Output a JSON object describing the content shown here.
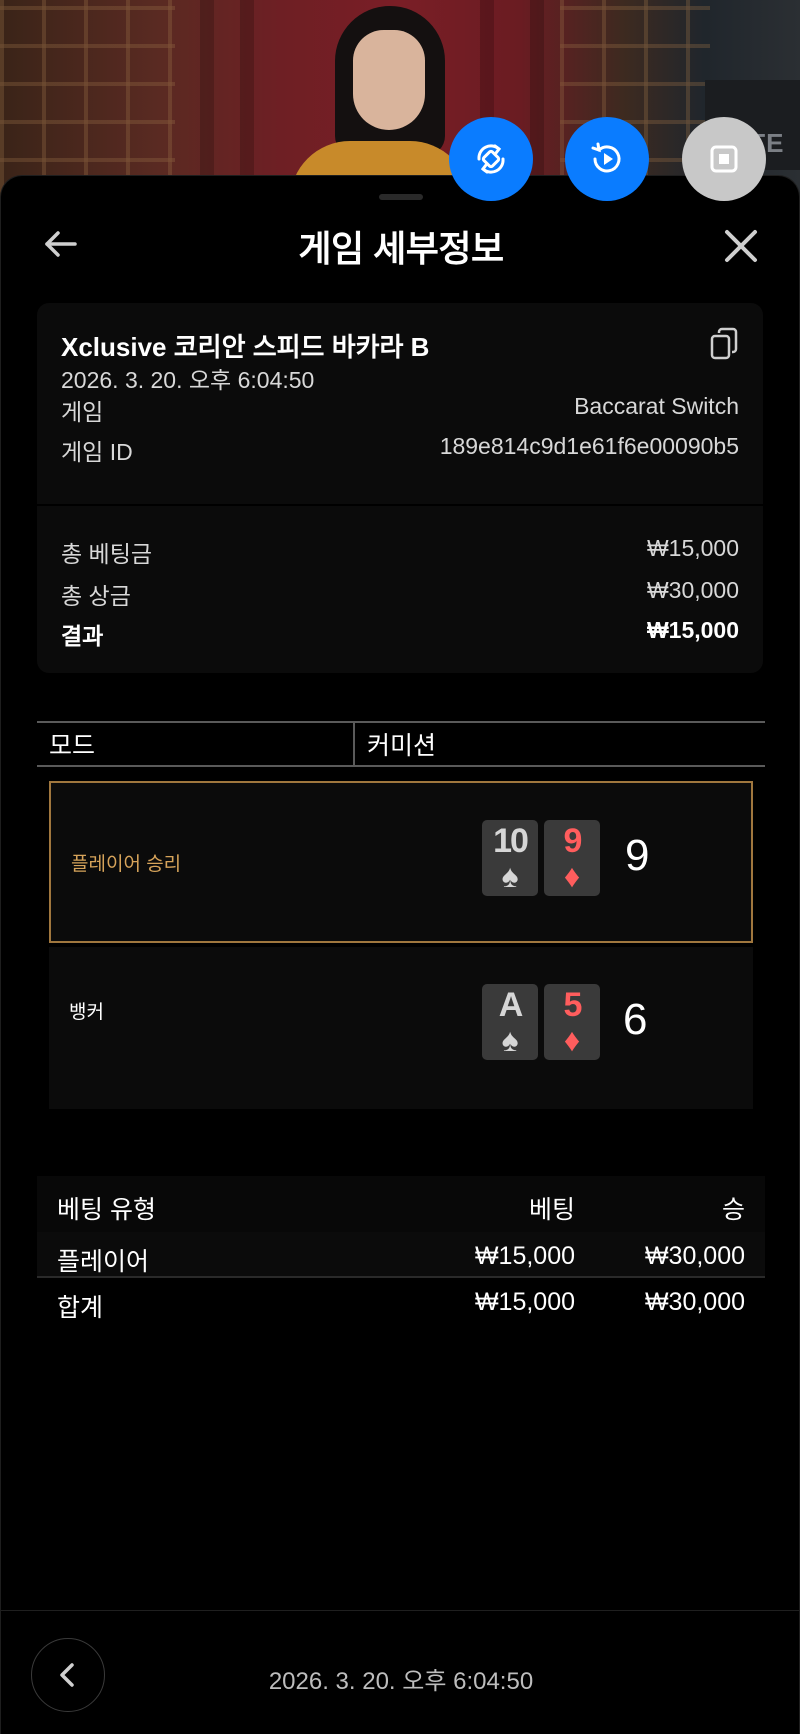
{
  "header": {
    "title": "게임 세부정보"
  },
  "game": {
    "name": "Xclusive 코리안 스피드 바카라 B",
    "datetime": "2026. 3. 20. 오후 6:04:50",
    "game_label": "게임",
    "game_value": "Baccarat Switch",
    "id_label": "게임 ID",
    "id_value": "189e814c9d1e61f6e00090b5"
  },
  "totals": {
    "bet_label": "총 베팅금",
    "bet_value": "₩15,000",
    "win_label": "총 상금",
    "win_value": "₩30,000",
    "result_label": "결과",
    "result_value": "₩15,000"
  },
  "mode": {
    "mode_label": "모드",
    "commission_label": "커미션"
  },
  "hands": {
    "player": {
      "label": "플레이어 승리",
      "cards": [
        {
          "rank": "10",
          "suit": "♠"
        },
        {
          "rank": "9",
          "suit": "♦"
        }
      ],
      "score": "9"
    },
    "banker": {
      "label": "뱅커",
      "cards": [
        {
          "rank": "A",
          "suit": "♠"
        },
        {
          "rank": "5",
          "suit": "♦"
        }
      ],
      "score": "6"
    }
  },
  "bets": {
    "headers": {
      "type": "베팅 유형",
      "bet": "베팅",
      "win": "승"
    },
    "rows": [
      {
        "type": "플레이어",
        "bet": "₩15,000",
        "win": "₩30,000"
      }
    ],
    "total": {
      "type": "합계",
      "bet": "₩15,000",
      "win": "₩30,000"
    }
  },
  "footer": {
    "datetime": "2026. 3. 20. 오후 6:04:50"
  },
  "colors": {
    "accent_blue": "#0a7cff",
    "winner_border": "#a0773e",
    "card_red": "#ff5d5d"
  },
  "icons": {
    "fab1": "rotate-screen-icon",
    "fab2": "replay-icon",
    "fab3": "stop-icon",
    "back": "arrow-left-icon",
    "close": "close-icon",
    "copy": "copy-icon",
    "prev": "chevron-left-icon"
  }
}
